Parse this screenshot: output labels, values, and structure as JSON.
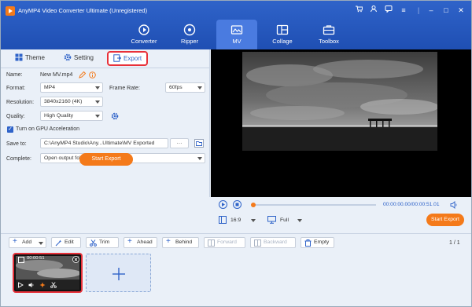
{
  "window": {
    "title": "AnyMP4 Video Converter Ultimate (Unregistered)"
  },
  "nav": [
    {
      "label": "Converter",
      "icon": "converter-icon"
    },
    {
      "label": "Ripper",
      "icon": "ripper-icon"
    },
    {
      "label": "MV",
      "icon": "mv-icon",
      "active": true
    },
    {
      "label": "Collage",
      "icon": "collage-icon"
    },
    {
      "label": "Toolbox",
      "icon": "toolbox-icon"
    }
  ],
  "tabs": [
    {
      "label": "Theme",
      "icon": "theme-icon"
    },
    {
      "label": "Setting",
      "icon": "gear-icon"
    },
    {
      "label": "Export",
      "icon": "export-icon",
      "active": true
    }
  ],
  "export": {
    "name_label": "Name:",
    "name_value": "New MV.mp4",
    "format_label": "Format:",
    "format_value": "MP4",
    "frame_rate_label": "Frame Rate:",
    "frame_rate_value": "60fps",
    "resolution_label": "Resolution:",
    "resolution_value": "3840x2160 (4K)",
    "quality_label": "Quality:",
    "quality_value": "High Quality",
    "gpu_label": "Turn on GPU Acceleration",
    "gpu_checked": true,
    "save_to_label": "Save to:",
    "save_to_value": "C:\\AnyMP4 Studio\\Any...Ultimate\\MV Exported",
    "save_to_more": "···",
    "complete_label": "Complete:",
    "complete_value": "Open output folder",
    "start_export": "Start Export"
  },
  "player": {
    "time": "00:00:00.00/00:00:51.01",
    "aspect": "16:9",
    "view": "Full",
    "start_export": "Start Export"
  },
  "toolbar": {
    "add": "Add",
    "edit": "Edit",
    "trim": "Trim",
    "ahead": "Ahead",
    "behind": "Behind",
    "forward": "Forward",
    "backward": "Backward",
    "empty": "Empty",
    "pages": "1 / 1"
  },
  "clip": {
    "time": "00:00:51"
  },
  "colors": {
    "brand_blue": "#2f63c9",
    "accent_orange": "#f47a1a",
    "highlight_red": "#e8313a"
  }
}
